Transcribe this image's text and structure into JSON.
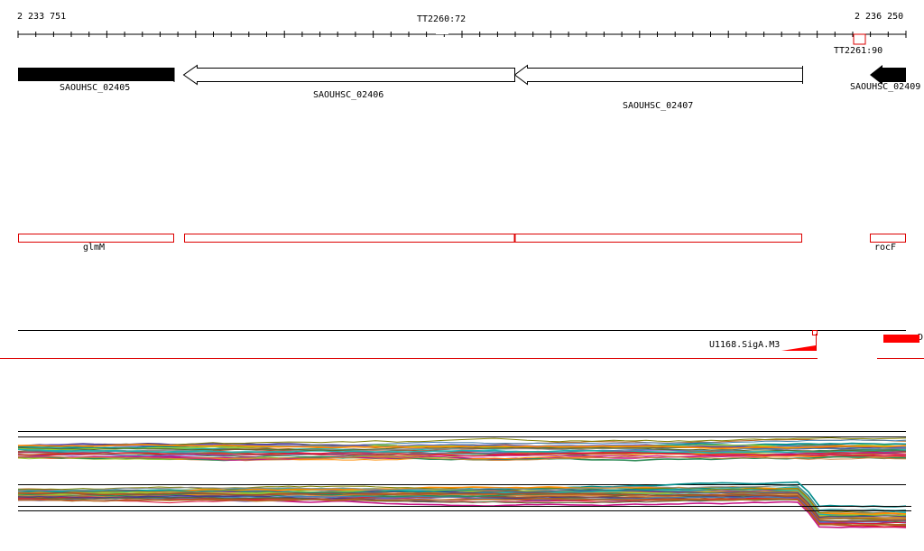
{
  "ruler": {
    "start_label": "2 233 751",
    "end_label": "2 236 250",
    "terminators": [
      {
        "label": "TT2260:72"
      },
      {
        "label": "TT2261:90"
      }
    ]
  },
  "genes": [
    {
      "label": "SAOUHSC_02405",
      "strand": "-",
      "style": "filled"
    },
    {
      "label": "SAOUHSC_02406",
      "strand": "-",
      "style": "outline"
    },
    {
      "label": "SAOUHSC_02407",
      "strand": "-",
      "style": "outline"
    },
    {
      "label": "SAOUHSC_02409",
      "strand": "-",
      "style": "filled"
    }
  ],
  "operons": [
    {
      "label": "glmM"
    },
    {
      "label": ""
    },
    {
      "label": ""
    },
    {
      "label": "rocF"
    }
  ],
  "promoter_track": {
    "label": "U1168.SigA.M3",
    "right_label_fragment": "D"
  },
  "colors": {
    "gene_fill": "#000000",
    "operon": "#dd0000",
    "promoter": "#ff0000",
    "track_line": "#000000"
  }
}
